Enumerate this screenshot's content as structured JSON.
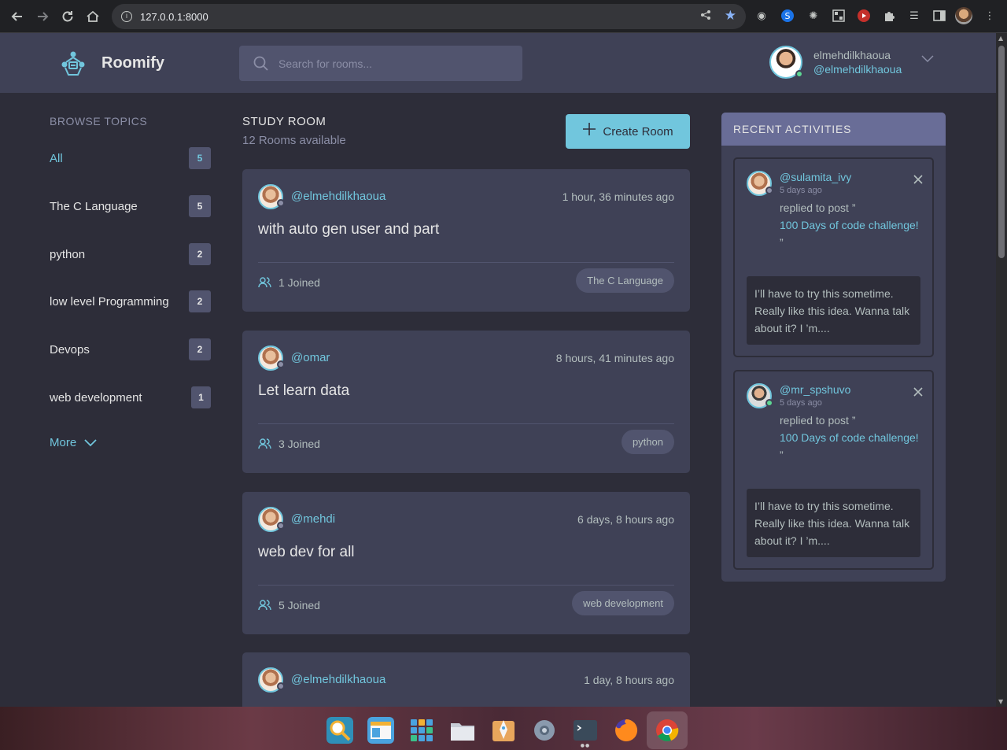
{
  "browser": {
    "url": "127.0.0.1:8000"
  },
  "app": {
    "brand": "Roomify",
    "search_placeholder": "Search for rooms...",
    "user": {
      "name": "elmehdilkhaoua",
      "handle": "@elmehdilkhaoua"
    }
  },
  "topics": {
    "title": "BROWSE TOPICS",
    "items": [
      {
        "label": "All",
        "count": "5"
      },
      {
        "label": "The C Language",
        "count": "5"
      },
      {
        "label": "python",
        "count": "2"
      },
      {
        "label": "low level Programming",
        "count": "2"
      },
      {
        "label": "Devops",
        "count": "2"
      },
      {
        "label": "web development",
        "count": "1"
      }
    ],
    "more_label": "More"
  },
  "feed": {
    "title": "STUDY ROOM",
    "subtitle": "12 Rooms available",
    "create_label": "Create Room",
    "rooms": [
      {
        "host": "@elmehdilkhaoua",
        "time": "1 hour, 36 minutes ago",
        "title": "with auto gen user and part",
        "joined": "1 Joined",
        "topic": "The C Language"
      },
      {
        "host": "@omar",
        "time": "8 hours, 41 minutes ago",
        "title": "Let learn data",
        "joined": "3 Joined",
        "topic": "python"
      },
      {
        "host": "@mehdi",
        "time": "6 days, 8 hours ago",
        "title": "web dev for all",
        "joined": "5 Joined",
        "topic": "web development"
      },
      {
        "host": "@elmehdilkhaoua",
        "time": "1 day, 8 hours ago"
      }
    ]
  },
  "activity": {
    "title": "RECENT ACTIVITIES",
    "items": [
      {
        "user": "@sulamita_ivy",
        "ago": "5 days ago",
        "action": "replied to post ”",
        "post": "100 Days of code challenge!",
        "end_quote": "”",
        "message": "I’ll have to try this sometime. Really like this idea. Wanna talk about it? I ’m...."
      },
      {
        "user": "@mr_spshuvo",
        "ago": "5 days ago",
        "action": "replied to post ”",
        "post": "100 Days of code challenge!",
        "end_quote": "”",
        "message": "I’ll have to try this sometime. Really like this idea. Wanna talk about it? I ’m...."
      }
    ]
  },
  "colors": {
    "accent": "#71c6dd",
    "background": "#2d2d39",
    "card": "#3f4156",
    "activity_header": "#696d97"
  }
}
